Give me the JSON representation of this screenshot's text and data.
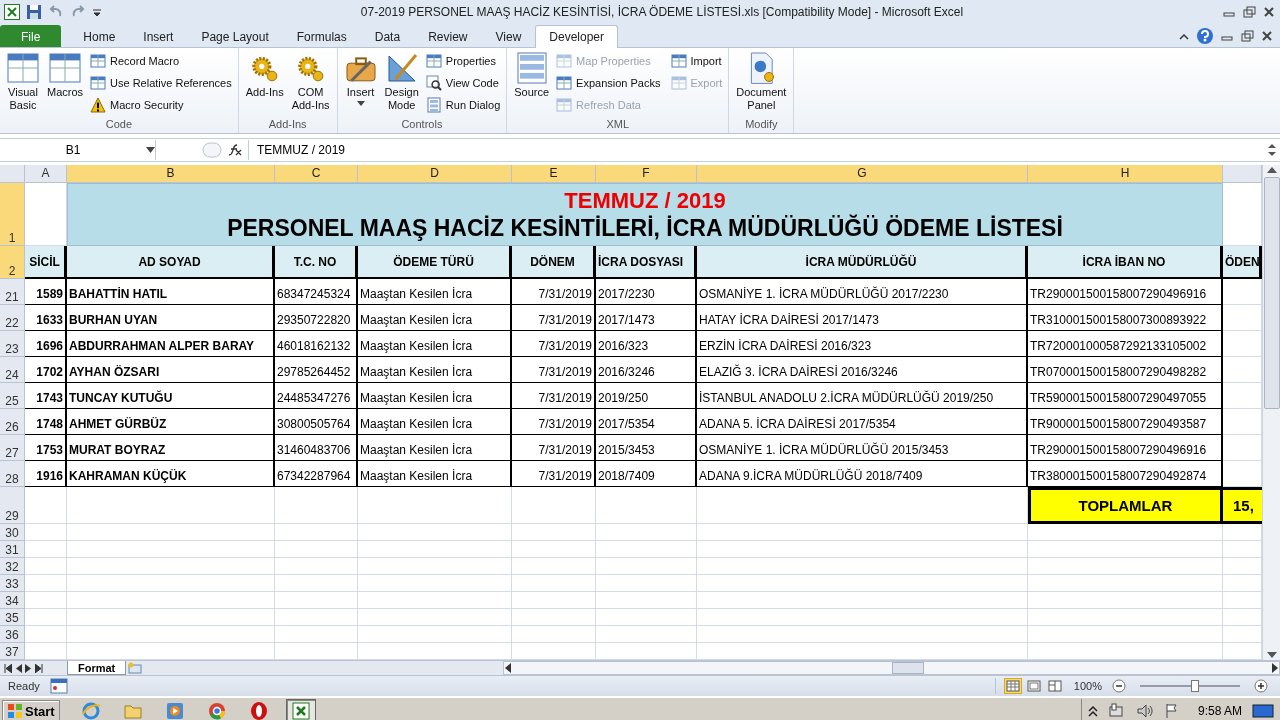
{
  "window": {
    "title": "07-2019 PERSONEL MAAŞ HACİZ KESİNTİSİ, İCRA ÖDEME LİSTESİ.xls  [Compatibility Mode]  -  Microsoft Excel"
  },
  "ribbon_tabs": [
    {
      "label": "File",
      "kind": "file",
      "selected": false
    },
    {
      "label": "Home",
      "kind": "tab",
      "selected": false
    },
    {
      "label": "Insert",
      "kind": "tab",
      "selected": false
    },
    {
      "label": "Page Layout",
      "kind": "tab",
      "selected": false
    },
    {
      "label": "Formulas",
      "kind": "tab",
      "selected": false
    },
    {
      "label": "Data",
      "kind": "tab",
      "selected": false
    },
    {
      "label": "Review",
      "kind": "tab",
      "selected": false
    },
    {
      "label": "View",
      "kind": "tab",
      "selected": false
    },
    {
      "label": "Developer",
      "kind": "tab",
      "selected": true
    }
  ],
  "ribbon_groups": [
    {
      "label": "Code",
      "buttons": [
        {
          "label": "Visual\nBasic",
          "kind": "large",
          "disabled": false
        },
        {
          "label": "Macros",
          "kind": "large",
          "disabled": false
        },
        {
          "label": "Record Macro",
          "kind": "small",
          "disabled": false
        },
        {
          "label": "Use Relative References",
          "kind": "small",
          "disabled": false
        },
        {
          "label": "Macro Security",
          "kind": "small",
          "disabled": false
        }
      ]
    },
    {
      "label": "Add-Ins",
      "buttons": [
        {
          "label": "Add-Ins",
          "kind": "large",
          "disabled": false
        },
        {
          "label": "COM\nAdd-Ins",
          "kind": "large",
          "disabled": false
        }
      ]
    },
    {
      "label": "Controls",
      "buttons": [
        {
          "label": "Insert",
          "kind": "large-menu",
          "disabled": false
        },
        {
          "label": "Design\nMode",
          "kind": "large",
          "disabled": false
        },
        {
          "label": "Properties",
          "kind": "small",
          "disabled": false
        },
        {
          "label": "View Code",
          "kind": "small",
          "disabled": false
        },
        {
          "label": "Run Dialog",
          "kind": "small",
          "disabled": false
        }
      ]
    },
    {
      "label": "XML",
      "buttons": [
        {
          "label": "Source",
          "kind": "large",
          "disabled": false
        },
        {
          "label": "Map Properties",
          "kind": "small",
          "disabled": true
        },
        {
          "label": "Expansion Packs",
          "kind": "small",
          "disabled": false
        },
        {
          "label": "Refresh Data",
          "kind": "small",
          "disabled": true
        },
        {
          "label": "Import",
          "kind": "small",
          "disabled": false
        },
        {
          "label": "Export",
          "kind": "small",
          "disabled": true
        }
      ]
    },
    {
      "label": "Modify",
      "buttons": [
        {
          "label": "Document\nPanel",
          "kind": "large",
          "disabled": false
        }
      ]
    }
  ],
  "formula_bar": {
    "name_box": "B1",
    "formula": "TEMMUZ / 2019"
  },
  "columns": [
    {
      "label": "A",
      "selected": false
    },
    {
      "label": "B",
      "selected": true
    },
    {
      "label": "C",
      "selected": true
    },
    {
      "label": "D",
      "selected": true
    },
    {
      "label": "E",
      "selected": true
    },
    {
      "label": "F",
      "selected": true
    },
    {
      "label": "G",
      "selected": true
    },
    {
      "label": "H",
      "selected": true
    }
  ],
  "row_headers": [
    {
      "label": "1",
      "selected": true
    },
    {
      "label": "2",
      "selected": true
    },
    {
      "label": "21",
      "selected": false
    },
    {
      "label": "22",
      "selected": false
    },
    {
      "label": "23",
      "selected": false
    },
    {
      "label": "24",
      "selected": false
    },
    {
      "label": "25",
      "selected": false
    },
    {
      "label": "26",
      "selected": false
    },
    {
      "label": "27",
      "selected": false
    },
    {
      "label": "28",
      "selected": false
    },
    {
      "label": "29",
      "selected": false
    },
    {
      "label": "30",
      "selected": false
    },
    {
      "label": "31",
      "selected": false
    },
    {
      "label": "32",
      "selected": false
    },
    {
      "label": "33",
      "selected": false
    },
    {
      "label": "34",
      "selected": false
    },
    {
      "label": "35",
      "selected": false
    },
    {
      "label": "36",
      "selected": false
    },
    {
      "label": "37",
      "selected": false
    }
  ],
  "sheet": {
    "period": "TEMMUZ / 2019",
    "title": "PERSONEL MAAŞ HACİZ KESİNTİLERİ, İCRA MÜDÜRLÜĞÜ ÖDEME LİSTESİ",
    "headers": [
      "SİCİL",
      "AD SOYAD",
      "T.C. NO",
      "ÖDEME TÜRÜ",
      "DÖNEM",
      "İCRA DOSYASI",
      "İCRA MÜDÜRLÜĞÜ",
      "İCRA İBAN NO",
      "ÖDEN"
    ],
    "rows": [
      [
        "1589",
        "BAHATTİN HATIL",
        "68347245324",
        "Maaştan Kesilen İcra",
        "7/31/2019",
        "2017/2230",
        "OSMANİYE 1. İCRA MÜDÜRLÜĞÜ 2017/2230",
        "TR290001500158007290496916"
      ],
      [
        "1633",
        "BURHAN UYAN",
        "29350722820",
        "Maaştan Kesilen İcra",
        "7/31/2019",
        "2017/1473",
        "HATAY İCRA DAİRESİ 2017/1473",
        "TR310001500158007300893922"
      ],
      [
        "1696",
        "ABDURRAHMAN ALPER BARAY",
        "46018162132",
        "Maaştan Kesilen İcra",
        "7/31/2019",
        "2016/323",
        "ERZİN İCRA DAİRESİ 2016/323",
        "TR720001000587292133105002"
      ],
      [
        "1702",
        "AYHAN ÖZSARI",
        "29785264452",
        "Maaştan Kesilen İcra",
        "7/31/2019",
        "2016/3246",
        "ELAZIĞ 3. İCRA DAİRESİ 2016/3246",
        "TR070001500158007290498282"
      ],
      [
        "1743",
        "TUNCAY KUTUĞU",
        "24485347276",
        "Maaştan Kesilen İcra",
        "7/31/2019",
        "2019/250",
        "İSTANBUL ANADOLU 2.İCRA MÜDÜRLÜĞÜ 2019/250",
        "TR590001500158007290497055"
      ],
      [
        "1748",
        "AHMET GÜRBÜZ",
        "30800505764",
        "Maaştan Kesilen İcra",
        "7/31/2019",
        "2017/5354",
        "ADANA 5. İCRA DAİRESİ 2017/5354",
        "TR900001500158007290493587"
      ],
      [
        "1753",
        "MURAT BOYRAZ",
        "31460483706",
        "Maaştan Kesilen İcra",
        "7/31/2019",
        "2015/3453",
        "OSMANİYE 1. İCRA MÜDÜRLÜĞÜ 2015/3453",
        "TR290001500158007290496916"
      ],
      [
        "1916",
        "KAHRAMAN KÜÇÜK",
        "67342287964",
        "Maaştan Kesilen İcra",
        "7/31/2019",
        "2018/7409",
        "ADANA 9.İCRA MÜDÜRLÜĞÜ 2018/7409",
        "TR380001500158007290492874"
      ]
    ],
    "totals": {
      "label": "TOPLAMLAR",
      "value": "15,"
    }
  },
  "sheet_tabs": [
    {
      "label": "Format",
      "selected": true
    }
  ],
  "status_bar": {
    "text": "Ready",
    "views": [
      {
        "selected": true
      },
      {
        "selected": false
      },
      {
        "selected": false
      }
    ],
    "zoom": "100%",
    "zoom_slider": {
      "level": 0.55
    }
  },
  "taskbar": {
    "start": "Start",
    "apps": [
      {
        "selected": false
      },
      {
        "selected": false
      },
      {
        "selected": false
      },
      {
        "selected": false
      },
      {
        "selected": false
      },
      {
        "selected": true
      }
    ],
    "time": "9:58 AM"
  }
}
